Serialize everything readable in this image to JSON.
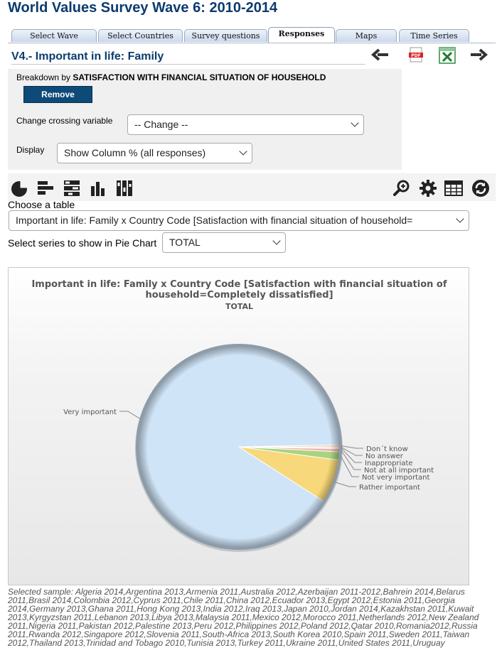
{
  "header": {
    "title": "World Values Survey Wave 6: 2010-2014"
  },
  "tabs": [
    {
      "label": "Select Wave"
    },
    {
      "label": "Select Countries"
    },
    {
      "label": "Survey questions"
    },
    {
      "label": "Responses",
      "active": true
    },
    {
      "label": "Maps"
    },
    {
      "label": "Time Series"
    }
  ],
  "variable": {
    "title": "V4.- Important in life: Family"
  },
  "nav_icons": [
    "arrow-left-icon",
    "pdf-icon",
    "excel-icon",
    "arrow-right-icon"
  ],
  "breakdown": {
    "prefix": "Breakdown by",
    "variable": "SATISFACTION WITH FINANCIAL SITUATION OF HOUSEHOLD",
    "remove_label": "Remove"
  },
  "crossing": {
    "label": "Change crossing variable",
    "value": "-- Change --"
  },
  "display": {
    "label": "Display",
    "value": "Show Column % (all responses)"
  },
  "toolbar": {
    "left_icons": [
      "pie-chart-icon",
      "horizontal-bar-icon",
      "stacked-bar-icon",
      "vertical-bar-icon",
      "stacked-column-icon"
    ],
    "right_icons": [
      "zoom-icon",
      "gear-icon",
      "table-icon",
      "refresh-icon"
    ]
  },
  "table_select": {
    "label": "Choose a table",
    "value": "Important in life: Family x Country Code [Satisfaction with financial situation of household="
  },
  "series_select": {
    "label": "Select series to show in Pie Chart",
    "value": "TOTAL"
  },
  "colors": {
    "brand": "#0b3b6e",
    "button": "#0e4a78"
  },
  "chart_data": {
    "type": "pie",
    "title": "Important in life: Family x Country Code [Satisfaction with financial situation of household=Completely dissatisfied]",
    "subtitle": "TOTAL",
    "categories": [
      "Very important",
      "Rather important",
      "Not very important",
      "Not at all important",
      "Inappropriate",
      "No answer",
      "Don´t know"
    ],
    "values": [
      90.6,
      7.0,
      1.3,
      0.5,
      0.2,
      0.1,
      0.3
    ],
    "colors": [
      "#cfe4f7",
      "#f7d87a",
      "#a9d47f",
      "#f2b0a6",
      "#d9c0e8",
      "#c8c8c8",
      "#f2c79a"
    ]
  },
  "sample": {
    "text": "Selected sample: Algeria 2014,Argentina 2013,Armenia 2011,Australia 2012,Azerbaijan 2011-2012,Bahrein 2014,Belarus 2011,Brasil 2014,Colombia 2012,Cyprus 2011,Chile 2011,China 2012,Ecuador 2013,Egypt 2012,Estonia 2011,Georgia 2014,Germany 2013,Ghana 2011,Hong Kong 2013,India 2012,Iraq 2013,Japan 2010,Jordan 2014,Kazakhstan 2011,Kuwait 2013,Kyrgyzstan 2011,Lebanon 2013,Libya 2013,Malaysia 2011,Mexico 2012,Morocco 2011,Netherlands 2012,New Zealand 2011,Nigeria 2011,Pakistan 2012,Palestine 2013,Peru 2012,Philippines 2012,Poland 2012,Qatar 2010,Romania2012,Russia 2011,Rwanda 2012,Singapore 2012,Slovenia 2011,South-Africa 2013,South Korea 2010,Spain 2011,Sweden 2011,Taiwan 2012,Thailand 2013,Trinidad and Tobago 2010,Tunisia 2013,Turkey 2011,Ukraine 2011,United States 2011,Uruguay"
  }
}
